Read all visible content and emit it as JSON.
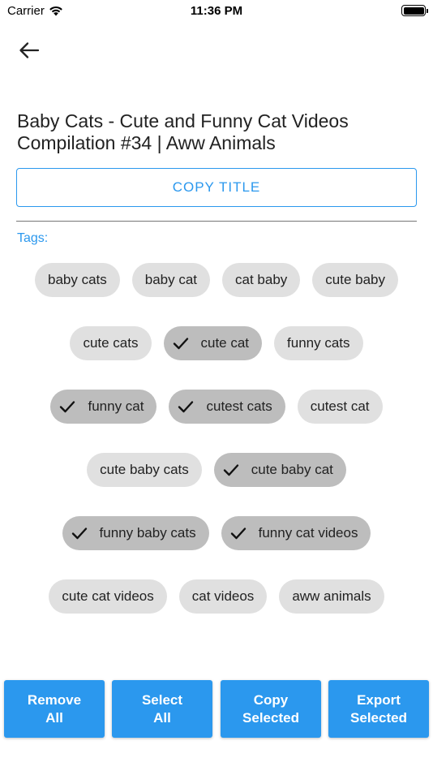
{
  "status_bar": {
    "carrier": "Carrier",
    "time": "11:36 PM"
  },
  "title": "Baby Cats - Cute and Funny Cat Videos Compilation #34 | Aww Animals",
  "copy_title_label": "COPY TITLE",
  "tags_label": "Tags:",
  "tag_rows": [
    [
      {
        "label": "baby cats",
        "selected": false
      },
      {
        "label": "baby cat",
        "selected": false
      },
      {
        "label": "cat baby",
        "selected": false
      },
      {
        "label": "cute baby",
        "selected": false
      }
    ],
    [
      {
        "label": "cute cats",
        "selected": false
      },
      {
        "label": "cute cat",
        "selected": true
      },
      {
        "label": "funny cats",
        "selected": false
      }
    ],
    [
      {
        "label": "funny cat",
        "selected": true
      },
      {
        "label": "cutest cats",
        "selected": true
      },
      {
        "label": "cutest cat",
        "selected": false
      }
    ],
    [
      {
        "label": "cute baby cats",
        "selected": false
      },
      {
        "label": "cute baby cat",
        "selected": true
      }
    ],
    [
      {
        "label": "funny baby cats",
        "selected": true
      },
      {
        "label": "funny cat videos",
        "selected": true
      }
    ],
    [
      {
        "label": "cute cat videos",
        "selected": false
      },
      {
        "label": "cat videos",
        "selected": false
      },
      {
        "label": "aww animals",
        "selected": false
      }
    ]
  ],
  "actions": {
    "remove_all": "Remove\nAll",
    "select_all": "Select\nAll",
    "copy_selected": "Copy\nSelected",
    "export_selected": "Export\nSelected"
  },
  "colors": {
    "accent": "#2b98ee",
    "chip": "#e0e0e0",
    "chip_selected": "#bdbdbd"
  },
  "icons": {
    "back": "arrow-left-icon",
    "check": "check-icon",
    "wifi": "wifi-icon",
    "battery": "battery-icon"
  }
}
